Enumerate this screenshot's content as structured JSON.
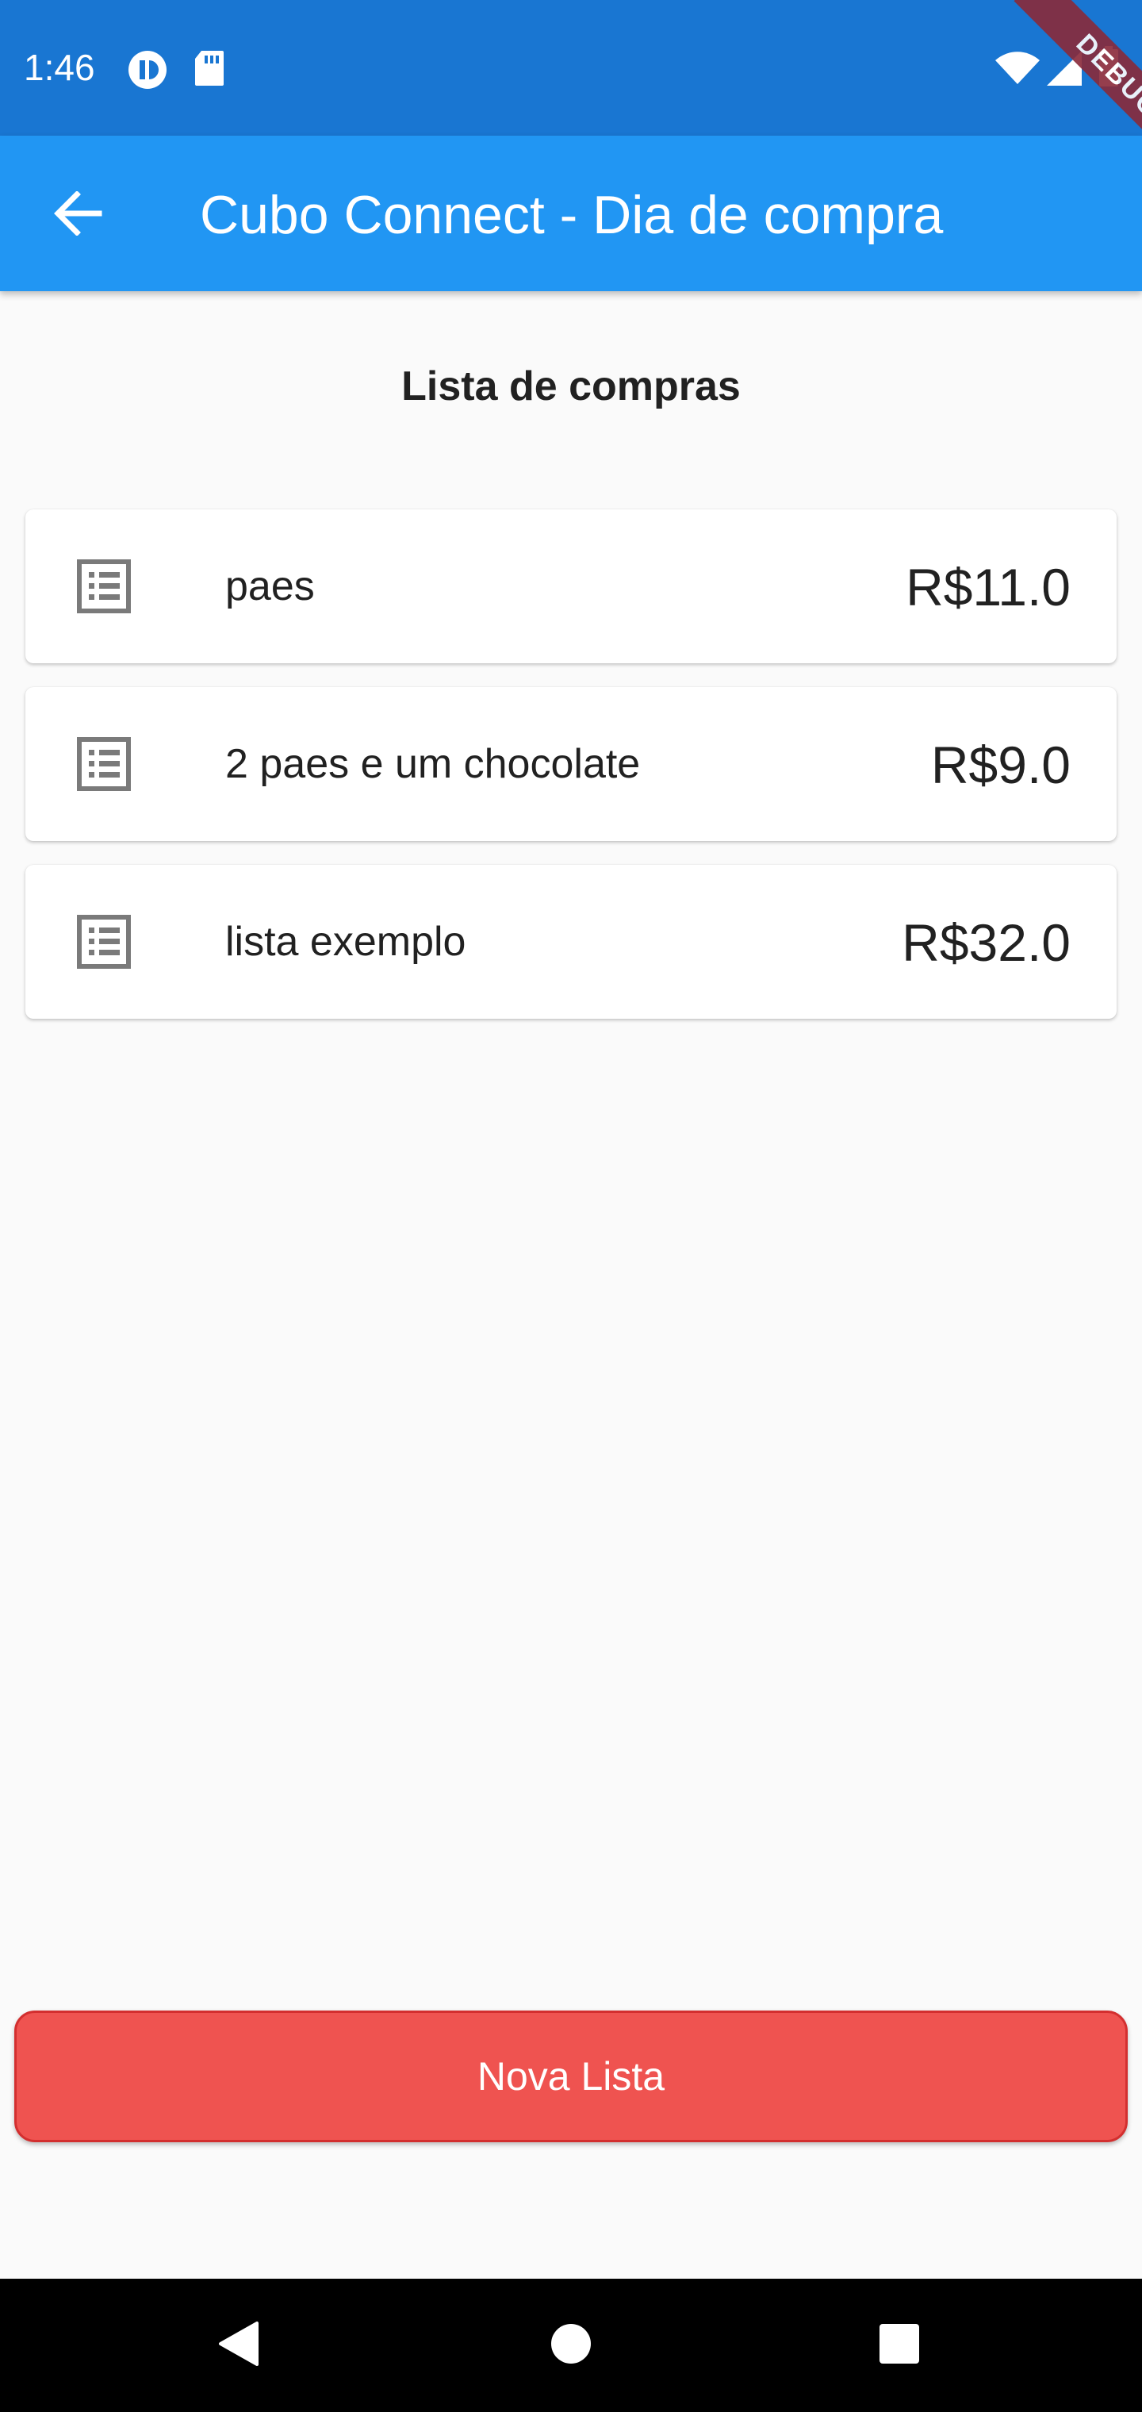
{
  "status_bar": {
    "time": "1:46",
    "debug_label": "DEBUG"
  },
  "app_bar": {
    "title": "Cubo Connect - Dia de compra"
  },
  "section": {
    "title": "Lista de compras"
  },
  "lists": [
    {
      "icon": "list-icon",
      "name": "paes",
      "price": "R$11.0"
    },
    {
      "icon": "list-icon",
      "name": "2 paes e um chocolate",
      "price": "R$9.0"
    },
    {
      "icon": "list-icon",
      "name": "lista exemplo",
      "price": "R$32.0"
    }
  ],
  "actions": {
    "new_list_label": "Nova Lista"
  },
  "colors": {
    "status_bar": "#1976d2",
    "app_bar": "#2196f3",
    "button": "#ef5350",
    "background": "#fafafa"
  }
}
